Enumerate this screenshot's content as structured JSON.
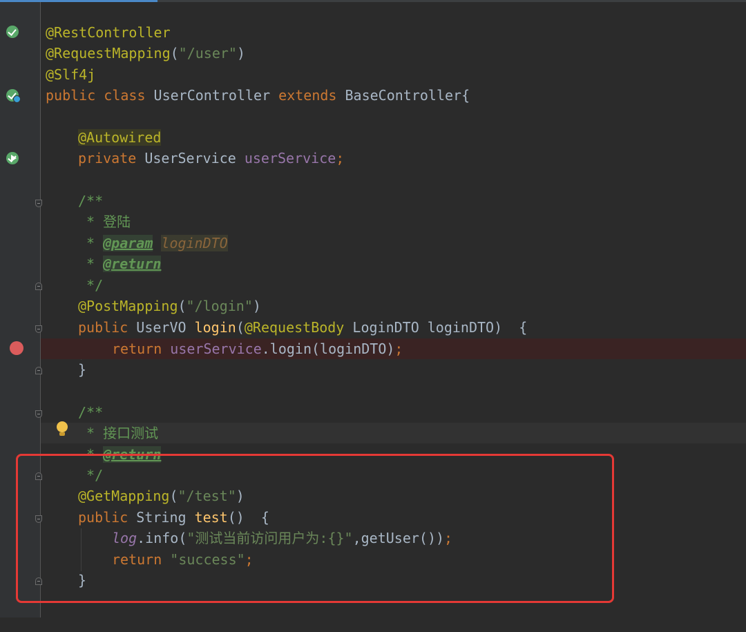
{
  "lines": {
    "l1": {
      "ann": "@RestController"
    },
    "l2": {
      "ann": "@RequestMapping",
      "p1": "(",
      "str": "\"/user\"",
      "p2": ")"
    },
    "l3": {
      "ann": "@Slf4j"
    },
    "l4": {
      "kw1": "public class ",
      "cls": "UserController ",
      "kw2": "extends ",
      "base": "BaseController{"
    },
    "l5": {
      "ann": "@Autowired"
    },
    "l6": {
      "kw": "private ",
      "type": "UserService ",
      "field": "userService",
      "semi": ";"
    },
    "l7": {
      "text": "/**"
    },
    "l8": {
      "text": " * 登陆"
    },
    "l9": {
      "star": " * ",
      "tag": "@param",
      "sp": " ",
      "param": "loginDTO"
    },
    "l10": {
      "star": " * ",
      "tag": "@return"
    },
    "l11": {
      "text": " */"
    },
    "l12": {
      "ann": "@PostMapping",
      "p1": "(",
      "str": "\"/login\"",
      "p2": ")"
    },
    "l13": {
      "kw": "public ",
      "type": "UserVO ",
      "name": "login",
      "p1": "(",
      "ann": "@RequestBody",
      "rest": " LoginDTO loginDTO)  {"
    },
    "l14": {
      "kw": "return ",
      "field": "userService",
      "rest": ".login(loginDTO)",
      "semi": ";"
    },
    "l15": {
      "text": "}"
    },
    "l16": {
      "text": "/**"
    },
    "l17": {
      "text": " * 接口测试"
    },
    "l18": {
      "star": " * ",
      "tag": "@return"
    },
    "l19": {
      "text": " */"
    },
    "l20": {
      "ann": "@GetMapping",
      "p1": "(",
      "str": "\"/test\"",
      "p2": ")"
    },
    "l21": {
      "kw": "public ",
      "type": "String ",
      "name": "test",
      "rest": "()  {"
    },
    "l22": {
      "log": "log",
      "call": ".info(",
      "str": "\"测试当前访问用户为:{}\"",
      "rest": ",getUser())",
      "semi": ";"
    },
    "l23": {
      "kw": "return ",
      "str": "\"success\"",
      "semi": ";"
    },
    "l24": {
      "text": "}"
    }
  },
  "gutter_icons": [
    "implemented-icon",
    "bean-icon",
    "autowired-bean-icon",
    "fold-icon",
    "breakpoint-icon",
    "intention-bulb-icon"
  ],
  "colors": {
    "background": "#2b2b2b",
    "gutter": "#313335",
    "keyword": "#cc7832",
    "annotation": "#bbb529",
    "string": "#6a8759",
    "field": "#9876aa",
    "method": "#ffc66d",
    "doc_comment": "#629755",
    "breakpoint": "#db5c5c",
    "highlight_box": "#e53935"
  }
}
